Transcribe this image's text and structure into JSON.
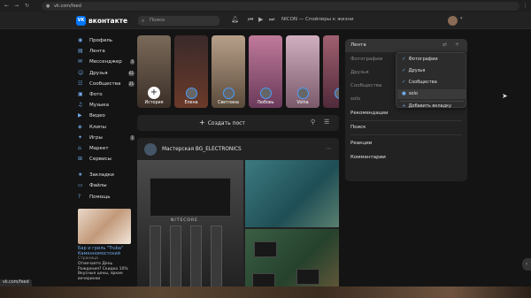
{
  "browser": {
    "url": "vk.com/feed",
    "status_url": "vk.com/feed"
  },
  "header": {
    "logo_text": "вконтакте",
    "search_placeholder": "Поиск",
    "player_track": "NICON — Спойлеры к жизни"
  },
  "sidebar": {
    "items": [
      {
        "label": "Профиль",
        "icon": "user-icon"
      },
      {
        "label": "Лента",
        "icon": "feed-icon"
      },
      {
        "label": "Мессенджер",
        "icon": "chat-icon",
        "count": "5"
      },
      {
        "label": "Друзья",
        "icon": "friends-icon",
        "count": "61"
      },
      {
        "label": "Сообщества",
        "icon": "groups-icon",
        "count": "21"
      },
      {
        "label": "Фото",
        "icon": "photo-icon"
      },
      {
        "label": "Музыка",
        "icon": "music-icon"
      },
      {
        "label": "Видео",
        "icon": "video-icon"
      },
      {
        "label": "Клипы",
        "icon": "clips-icon"
      },
      {
        "label": "Игры",
        "icon": "games-icon",
        "count": "1"
      },
      {
        "label": "Маркет",
        "icon": "market-icon"
      },
      {
        "label": "Сервисы",
        "icon": "services-icon"
      }
    ],
    "secondary": [
      {
        "label": "Закладки",
        "icon": "bookmark-icon"
      },
      {
        "label": "Файлы",
        "icon": "files-icon"
      },
      {
        "label": "Помощь",
        "icon": "help-icon"
      }
    ]
  },
  "promo": {
    "title": "Бар и гриль \"Truba\" Каменномостский",
    "subtitle": "Страница",
    "text": "Отмечаете День Рождения? Скидка 10% Вкусные цены, яркие вечеринки"
  },
  "stories": [
    {
      "name": "История",
      "own": true
    },
    {
      "name": "Елена"
    },
    {
      "name": "Светлана"
    },
    {
      "name": "Любовь"
    },
    {
      "name": "Volna"
    },
    {
      "name": ""
    }
  ],
  "create_post": {
    "label": "Создать пост"
  },
  "post": {
    "author": "Мастерская BG_ELECTRONICS",
    "device_brand": "NITECORE"
  },
  "right_panel": {
    "active": "Лента",
    "items": [
      "Фотографии",
      "Друзья",
      "Сообщества",
      "solo",
      "Рекомендации",
      "Поиск",
      "Реакции",
      "Комментарии"
    ]
  },
  "dropdown": {
    "items": [
      {
        "label": "Фотографии",
        "checked": true
      },
      {
        "label": "Друзья",
        "checked": true
      },
      {
        "label": "Сообщества",
        "checked": true
      },
      {
        "label": "solo",
        "checked": false
      }
    ],
    "add_label": "Добавить вкладку"
  },
  "colors": {
    "accent": "#71aaeb",
    "brand": "#0077ff",
    "background": "#141414",
    "panel": "#222222"
  }
}
